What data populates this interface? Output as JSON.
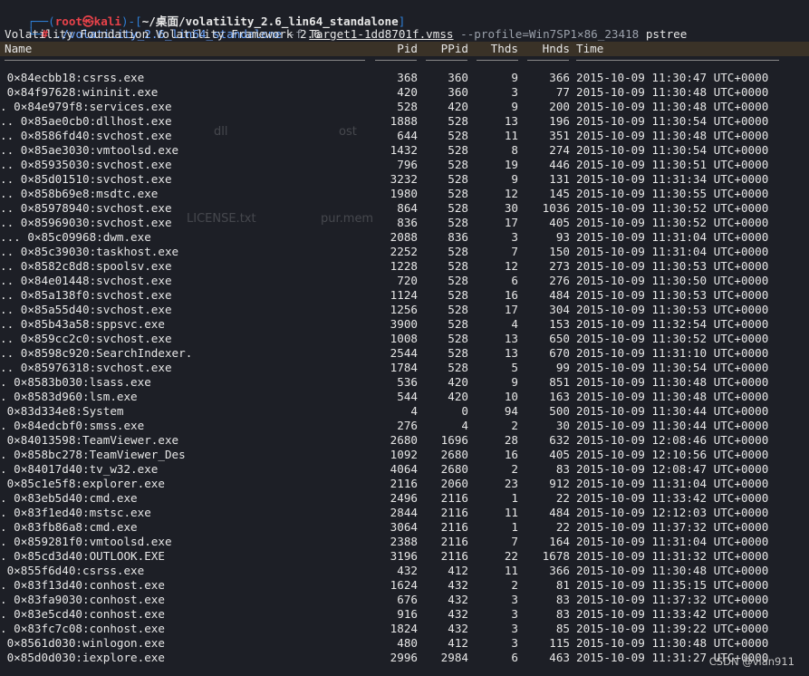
{
  "prompt": {
    "user": "root㉿kali",
    "path": "~/桌面/volatility_2.6_lin64_standalone",
    "hash": "#",
    "command": "./volatility_2.6_lin64_standalone",
    "flag_f": "-f",
    "file": "Target1-1dd8701f.vmss",
    "profile": "--profile=Win7SP1×86_23418",
    "subcommand": "pstree"
  },
  "banner": "Volatility Foundation Volatility Framework 2.6",
  "columns": {
    "name": "Name",
    "pid": "Pid",
    "ppid": "PPid",
    "thds": "Thds",
    "hnds": "Hnds",
    "time": "Time"
  },
  "rows": [
    {
      "name": " 0×84ecbb18:csrss.exe",
      "pid": "368",
      "ppid": "360",
      "thds": "9",
      "hnds": "366",
      "time": "2015-10-09 11:30:47 UTC+0000"
    },
    {
      "name": " 0×84f97628:wininit.exe",
      "pid": "420",
      "ppid": "360",
      "thds": "3",
      "hnds": "77",
      "time": "2015-10-09 11:30:48 UTC+0000"
    },
    {
      "name": ". 0×84e979f8:services.exe",
      "pid": "528",
      "ppid": "420",
      "thds": "9",
      "hnds": "200",
      "time": "2015-10-09 11:30:48 UTC+0000"
    },
    {
      "name": ".. 0×85ae0cb0:dllhost.exe",
      "pid": "1888",
      "ppid": "528",
      "thds": "13",
      "hnds": "196",
      "time": "2015-10-09 11:30:54 UTC+0000"
    },
    {
      "name": ".. 0×8586fd40:svchost.exe",
      "pid": "644",
      "ppid": "528",
      "thds": "11",
      "hnds": "351",
      "time": "2015-10-09 11:30:48 UTC+0000"
    },
    {
      "name": ".. 0×85ae3030:vmtoolsd.exe",
      "pid": "1432",
      "ppid": "528",
      "thds": "8",
      "hnds": "274",
      "time": "2015-10-09 11:30:54 UTC+0000"
    },
    {
      "name": ".. 0×85935030:svchost.exe",
      "pid": "796",
      "ppid": "528",
      "thds": "19",
      "hnds": "446",
      "time": "2015-10-09 11:30:51 UTC+0000"
    },
    {
      "name": ".. 0×85d01510:svchost.exe",
      "pid": "3232",
      "ppid": "528",
      "thds": "9",
      "hnds": "131",
      "time": "2015-10-09 11:31:34 UTC+0000"
    },
    {
      "name": ".. 0×858b69e8:msdtc.exe",
      "pid": "1980",
      "ppid": "528",
      "thds": "12",
      "hnds": "145",
      "time": "2015-10-09 11:30:55 UTC+0000"
    },
    {
      "name": ".. 0×85978940:svchost.exe",
      "pid": "864",
      "ppid": "528",
      "thds": "30",
      "hnds": "1036",
      "time": "2015-10-09 11:30:52 UTC+0000"
    },
    {
      "name": ".. 0×85969030:svchost.exe",
      "pid": "836",
      "ppid": "528",
      "thds": "17",
      "hnds": "405",
      "time": "2015-10-09 11:30:52 UTC+0000"
    },
    {
      "name": "... 0×85c09968:dwm.exe",
      "pid": "2088",
      "ppid": "836",
      "thds": "3",
      "hnds": "93",
      "time": "2015-10-09 11:31:04 UTC+0000"
    },
    {
      "name": ".. 0×85c39030:taskhost.exe",
      "pid": "2252",
      "ppid": "528",
      "thds": "7",
      "hnds": "150",
      "time": "2015-10-09 11:31:04 UTC+0000"
    },
    {
      "name": ".. 0×8582c8d8:spoolsv.exe",
      "pid": "1228",
      "ppid": "528",
      "thds": "12",
      "hnds": "273",
      "time": "2015-10-09 11:30:53 UTC+0000"
    },
    {
      "name": ".. 0×84e01448:svchost.exe",
      "pid": "720",
      "ppid": "528",
      "thds": "6",
      "hnds": "276",
      "time": "2015-10-09 11:30:50 UTC+0000"
    },
    {
      "name": ".. 0×85a138f0:svchost.exe",
      "pid": "1124",
      "ppid": "528",
      "thds": "16",
      "hnds": "484",
      "time": "2015-10-09 11:30:53 UTC+0000"
    },
    {
      "name": ".. 0×85a55d40:svchost.exe",
      "pid": "1256",
      "ppid": "528",
      "thds": "17",
      "hnds": "304",
      "time": "2015-10-09 11:30:53 UTC+0000"
    },
    {
      "name": ".. 0×85b43a58:sppsvc.exe",
      "pid": "3900",
      "ppid": "528",
      "thds": "4",
      "hnds": "153",
      "time": "2015-10-09 11:32:54 UTC+0000"
    },
    {
      "name": ".. 0×859cc2c0:svchost.exe",
      "pid": "1008",
      "ppid": "528",
      "thds": "13",
      "hnds": "650",
      "time": "2015-10-09 11:30:52 UTC+0000"
    },
    {
      "name": ".. 0×8598c920:SearchIndexer.",
      "pid": "2544",
      "ppid": "528",
      "thds": "13",
      "hnds": "670",
      "time": "2015-10-09 11:31:10 UTC+0000"
    },
    {
      "name": ".. 0×85976318:svchost.exe",
      "pid": "1784",
      "ppid": "528",
      "thds": "5",
      "hnds": "99",
      "time": "2015-10-09 11:30:54 UTC+0000"
    },
    {
      "name": ". 0×8583b030:lsass.exe",
      "pid": "536",
      "ppid": "420",
      "thds": "9",
      "hnds": "851",
      "time": "2015-10-09 11:30:48 UTC+0000"
    },
    {
      "name": ". 0×8583d960:lsm.exe",
      "pid": "544",
      "ppid": "420",
      "thds": "10",
      "hnds": "163",
      "time": "2015-10-09 11:30:48 UTC+0000"
    },
    {
      "name": " 0×83d334e8:System",
      "pid": "4",
      "ppid": "0",
      "thds": "94",
      "hnds": "500",
      "time": "2015-10-09 11:30:44 UTC+0000"
    },
    {
      "name": ". 0×84edcbf0:smss.exe",
      "pid": "276",
      "ppid": "4",
      "thds": "2",
      "hnds": "30",
      "time": "2015-10-09 11:30:44 UTC+0000"
    },
    {
      "name": " 0×84013598:TeamViewer.exe",
      "pid": "2680",
      "ppid": "1696",
      "thds": "28",
      "hnds": "632",
      "time": "2015-10-09 12:08:46 UTC+0000"
    },
    {
      "name": ". 0×858bc278:TeamViewer_Des",
      "pid": "1092",
      "ppid": "2680",
      "thds": "16",
      "hnds": "405",
      "time": "2015-10-09 12:10:56 UTC+0000"
    },
    {
      "name": ". 0×84017d40:tv_w32.exe",
      "pid": "4064",
      "ppid": "2680",
      "thds": "2",
      "hnds": "83",
      "time": "2015-10-09 12:08:47 UTC+0000"
    },
    {
      "name": " 0×85c1e5f8:explorer.exe",
      "pid": "2116",
      "ppid": "2060",
      "thds": "23",
      "hnds": "912",
      "time": "2015-10-09 11:31:04 UTC+0000"
    },
    {
      "name": ". 0×83eb5d40:cmd.exe",
      "pid": "2496",
      "ppid": "2116",
      "thds": "1",
      "hnds": "22",
      "time": "2015-10-09 11:33:42 UTC+0000"
    },
    {
      "name": ". 0×83f1ed40:mstsc.exe",
      "pid": "2844",
      "ppid": "2116",
      "thds": "11",
      "hnds": "484",
      "time": "2015-10-09 12:12:03 UTC+0000"
    },
    {
      "name": ". 0×83fb86a8:cmd.exe",
      "pid": "3064",
      "ppid": "2116",
      "thds": "1",
      "hnds": "22",
      "time": "2015-10-09 11:37:32 UTC+0000"
    },
    {
      "name": ". 0×859281f0:vmtoolsd.exe",
      "pid": "2388",
      "ppid": "2116",
      "thds": "7",
      "hnds": "164",
      "time": "2015-10-09 11:31:04 UTC+0000"
    },
    {
      "name": ". 0×85cd3d40:OUTLOOK.EXE",
      "pid": "3196",
      "ppid": "2116",
      "thds": "22",
      "hnds": "1678",
      "time": "2015-10-09 11:31:32 UTC+0000"
    },
    {
      "name": " 0×855f6d40:csrss.exe",
      "pid": "432",
      "ppid": "412",
      "thds": "11",
      "hnds": "366",
      "time": "2015-10-09 11:30:48 UTC+0000"
    },
    {
      "name": ". 0×83f13d40:conhost.exe",
      "pid": "1624",
      "ppid": "432",
      "thds": "2",
      "hnds": "81",
      "time": "2015-10-09 11:35:15 UTC+0000"
    },
    {
      "name": ". 0×83fa9030:conhost.exe",
      "pid": "676",
      "ppid": "432",
      "thds": "3",
      "hnds": "83",
      "time": "2015-10-09 11:37:32 UTC+0000"
    },
    {
      "name": ". 0×83e5cd40:conhost.exe",
      "pid": "916",
      "ppid": "432",
      "thds": "3",
      "hnds": "83",
      "time": "2015-10-09 11:33:42 UTC+0000"
    },
    {
      "name": ". 0×83fc7c08:conhost.exe",
      "pid": "1824",
      "ppid": "432",
      "thds": "3",
      "hnds": "85",
      "time": "2015-10-09 11:39:22 UTC+0000"
    },
    {
      "name": " 0×8561d030:winlogon.exe",
      "pid": "480",
      "ppid": "412",
      "thds": "3",
      "hnds": "115",
      "time": "2015-10-09 11:30:48 UTC+0000"
    },
    {
      "name": " 0×85d0d030:iexplore.exe",
      "pid": "2996",
      "ppid": "2984",
      "thds": "6",
      "hnds": "463",
      "time": "2015-10-09 11:31:27 UTC+0000"
    }
  ],
  "ghost_labels": [
    "dll",
    "ost",
    "LICENSE.txt",
    "pur.mem"
  ],
  "watermark": "CSDN @vlan911"
}
